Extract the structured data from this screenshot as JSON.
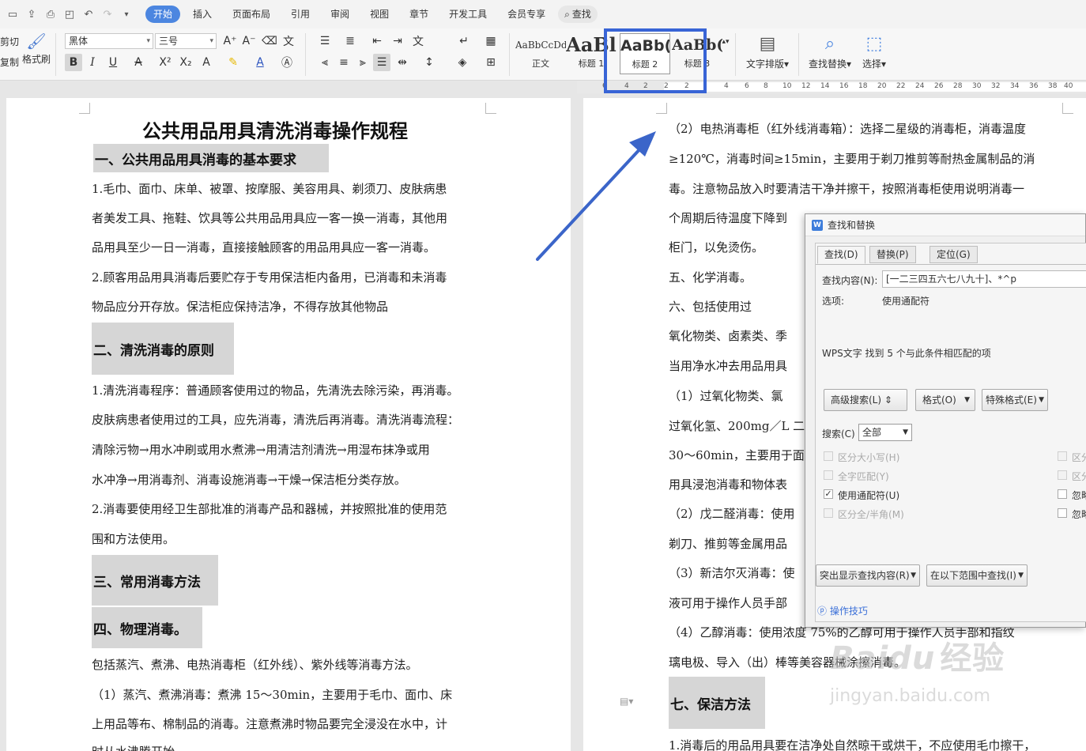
{
  "menubar": {
    "tabs": [
      "开始",
      "插入",
      "页面布局",
      "引用",
      "审阅",
      "视图",
      "章节",
      "开发工具",
      "会员专享"
    ],
    "search_label": "查找"
  },
  "ribbon": {
    "cut_label": "剪切",
    "copy_label": "复制",
    "format_painter_label": "格式刷",
    "font_name": "黑体",
    "font_size": "三号",
    "styles": [
      {
        "sample": "AaBbCcDd",
        "label": "正文"
      },
      {
        "sample": "AaBl",
        "label": "标题 1"
      },
      {
        "sample": "AaBb(",
        "label": "标题 2"
      },
      {
        "sample": "AaBb(",
        "label": "标题 3"
      }
    ],
    "text_layout_label": "文字排版",
    "find_replace_label": "查找替换",
    "select_label": "选择"
  },
  "ruler": {
    "numbers": [
      "6",
      "4",
      "2",
      "2",
      "2",
      "4",
      "6",
      "8",
      "10",
      "12",
      "14",
      "16",
      "18",
      "20",
      "22",
      "24",
      "26",
      "28",
      "30",
      "32",
      "34",
      "36",
      "38",
      "40"
    ]
  },
  "left_page": {
    "title": "公共用品用具清洗消毒操作规程",
    "blocks": [
      {
        "type": "heading",
        "text": "一、公共用品用具消毒的基本要求"
      },
      {
        "type": "para",
        "text": "1.毛巾、面巾、床单、被罩、按摩服、美容用具、剃须刀、皮肤病患"
      },
      {
        "type": "para",
        "text": "者美发工具、拖鞋、饮具等公共用品用具应一客一换一消毒，其他用"
      },
      {
        "type": "para",
        "text": "品用具至少一日一消毒，直接接触顾客的用品用具应一客一消毒。"
      },
      {
        "type": "para",
        "text": "2.顾客用品用具消毒后要贮存于专用保洁柜内备用，已消毒和未消毒"
      },
      {
        "type": "para",
        "text": "物品应分开存放。保洁柜应保持洁净，不得存放其他物品"
      },
      {
        "type": "heading",
        "text": "二、清洗消毒的原则"
      },
      {
        "type": "para",
        "text": "1.清洗消毒程序：普通顾客使用过的物品，先清洗去除污染，再消毒。"
      },
      {
        "type": "para",
        "text": "皮肤病患者使用过的工具，应先消毒，清洗后再消毒。清洗消毒流程："
      },
      {
        "type": "para",
        "text": "清除污物→用水冲刷或用水煮沸→用清洁剂清洗→用湿布抹净或用"
      },
      {
        "type": "para",
        "text": "水冲净→用消毒剂、消毒设施消毒→干燥→保洁柜分类存放。"
      },
      {
        "type": "para",
        "text": "2.消毒要使用经卫生部批准的消毒产品和器械，并按照批准的使用范"
      },
      {
        "type": "para",
        "text": "围和方法使用。"
      },
      {
        "type": "heading",
        "text": "三、常用消毒方法"
      },
      {
        "type": "heading",
        "text": "四、物理消毒。"
      },
      {
        "type": "para",
        "text": "包括蒸汽、煮沸、电热消毒柜（红外线）、紫外线等消毒方法。"
      },
      {
        "type": "para",
        "text": "（1）蒸汽、煮沸消毒：煮沸 15～30min，主要用于毛巾、面巾、床"
      },
      {
        "type": "para",
        "text": "上用品等布、棉制品的消毒。注意煮沸时物品要完全浸没在水中，计"
      },
      {
        "type": "para",
        "text": "时从水沸腾开始。"
      }
    ]
  },
  "right_page": {
    "blocks": [
      {
        "type": "para",
        "text": "（2）电热消毒柜（红外线消毒箱）：选择二星级的消毒柜，消毒温度"
      },
      {
        "type": "para",
        "text": "≥120℃，消毒时间≥15min，主要用于剃刀推剪等耐热金属制品的消"
      },
      {
        "type": "para",
        "text": "毒。注意物品放入时要清洁干净并擦干，按照消毒柜使用说明消毒一"
      },
      {
        "type": "para",
        "text": "个周期后待温度下降到"
      },
      {
        "type": "para",
        "text": "柜门，以免烫伤。"
      },
      {
        "type": "para",
        "text": "五、化学消毒。"
      },
      {
        "type": "para",
        "text": "六、包括使用过"
      },
      {
        "type": "para",
        "text": "氧化物类、卤素类、季"
      },
      {
        "type": "para",
        "text": "当用净水冲去用品用具"
      },
      {
        "type": "para",
        "text": "（1）过氧化物类、氯"
      },
      {
        "type": "para",
        "text": "过氧化氢、200mg／L 二"
      },
      {
        "type": "para",
        "text": "30～60min，主要用于面"
      },
      {
        "type": "para",
        "text": "用具浸泡消毒和物体表"
      },
      {
        "type": "para",
        "text": "（2）戊二醛消毒：使用"
      },
      {
        "type": "para",
        "text": "剃刀、推剪等金属用品"
      },
      {
        "type": "para",
        "text": "（3）新洁尔灭消毒：使"
      },
      {
        "type": "para",
        "text": "液可用于操作人员手部"
      },
      {
        "type": "para",
        "text": "（4）乙醇消毒：使用浓度 75%的乙醇可用于操作人员手部和指纹"
      },
      {
        "type": "para",
        "text": "璃电极、导入（出）棒等美容器械涂擦消毒。"
      },
      {
        "type": "heading",
        "text": "七、保洁方法"
      },
      {
        "type": "para",
        "text": "1.消毒后的用品用具要在洁净处自然晾干或烘干，不应使用毛巾擦干，"
      }
    ]
  },
  "dialog": {
    "title": "查找和替换",
    "tabs": [
      "查找(D)",
      "替换(P)",
      "定位(G)"
    ],
    "find_label": "查找内容(N):",
    "find_value": "[一二三四五六七八九十]、*^p",
    "options_label": "选项:",
    "options_value": "使用通配符",
    "result_text": "WPS文字 找到 5 个与此条件相匹配的项",
    "advanced_button": "高级搜索(L) ⇕",
    "format_button": "格式(O)",
    "special_button": "特殊格式(E)",
    "search_label": "搜索(C)",
    "search_scope": "全部",
    "checkboxes_left": [
      {
        "label": "区分大小写(H)",
        "checked": false,
        "disabled": true
      },
      {
        "label": "全字匹配(Y)",
        "checked": false,
        "disabled": true
      },
      {
        "label": "使用通配符(U)",
        "checked": true,
        "disabled": false
      },
      {
        "label": "区分全/半角(M)",
        "checked": false,
        "disabled": true
      }
    ],
    "checkboxes_right": [
      {
        "label": "区分",
        "disabled": true
      },
      {
        "label": "区分",
        "disabled": true
      },
      {
        "label": "忽略",
        "disabled": false
      },
      {
        "label": "忽略",
        "disabled": false
      }
    ],
    "highlight_button": "突出显示查找内容(R)",
    "find_in_button": "在以下范围中查找(I)",
    "tips_link": "操作技巧"
  },
  "watermark": {
    "brand": "Baidu",
    "brand_cn": "经验",
    "url": "jingyan.baidu.com"
  },
  "colors": {
    "accent": "#4c86e0",
    "highlight_box": "#3864d6",
    "arrow": "#3b65c9",
    "heading_bg": "#d6d6d6"
  }
}
